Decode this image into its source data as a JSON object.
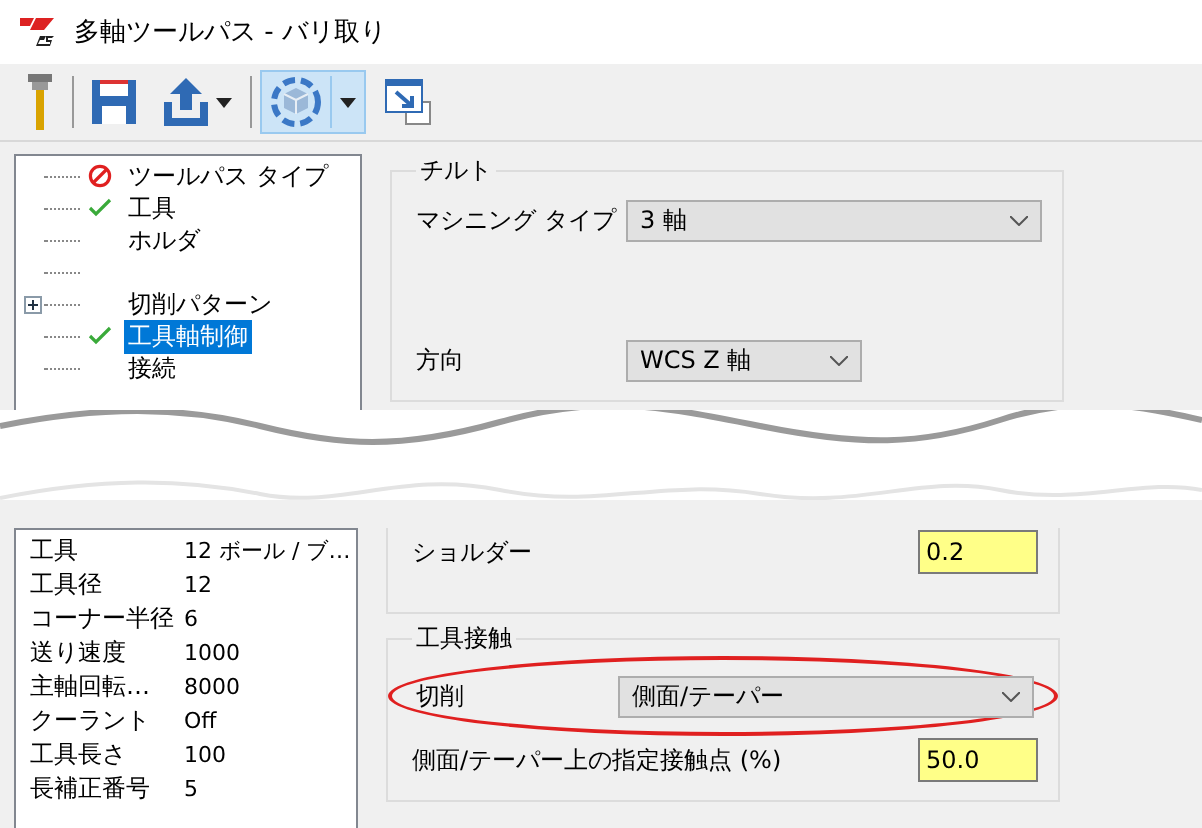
{
  "window": {
    "title": "多軸ツールパス - バリ取り"
  },
  "toolbar": [
    {
      "kind": "tool",
      "selected": false,
      "menu": false
    },
    {
      "kind": "save",
      "selected": false,
      "menu": false
    },
    {
      "kind": "export",
      "selected": false,
      "menu": true
    },
    {
      "kind": "view",
      "selected": true,
      "menu": true
    },
    {
      "kind": "window",
      "selected": false,
      "menu": false
    }
  ],
  "tree": [
    {
      "kind": "item",
      "label": "ツールパス タイプ",
      "error": true,
      "checked": false,
      "expandable": false,
      "selected": false
    },
    {
      "kind": "item",
      "label": "工具",
      "error": false,
      "checked": true,
      "expandable": false,
      "selected": false
    },
    {
      "kind": "item",
      "label": "ホルダ",
      "error": false,
      "checked": false,
      "expandable": false,
      "selected": false
    },
    {
      "kind": "blank"
    },
    {
      "kind": "item",
      "label": "切削パターン",
      "error": false,
      "checked": false,
      "expandable": true,
      "selected": false
    },
    {
      "kind": "item",
      "label": "工具軸制御",
      "error": false,
      "checked": true,
      "expandable": false,
      "selected": true
    },
    {
      "kind": "item",
      "label": "接続",
      "error": false,
      "checked": false,
      "expandable": false,
      "selected": false
    }
  ],
  "tilt": {
    "legend": "チルト",
    "machining_type": {
      "label": "マシニング タイプ",
      "value": "3 軸"
    },
    "direction": {
      "label": "方向",
      "value": "WCS Z 軸"
    }
  },
  "tool_info": [
    {
      "name": "工具",
      "value": "12 ボール / ブ…"
    },
    {
      "name": "工具径",
      "value": "12"
    },
    {
      "name": "コーナー半径",
      "value": "6"
    },
    {
      "name": "送り速度",
      "value": "1000"
    },
    {
      "name": "主軸回転…",
      "value": "8000"
    },
    {
      "name": "クーラント",
      "value": "Off"
    },
    {
      "name": "工具長さ",
      "value": "100"
    },
    {
      "name": "長補正番号",
      "value": "5"
    }
  ],
  "shoulder": {
    "label": "ショルダー",
    "value": "0.2"
  },
  "contact": {
    "legend": "工具接触",
    "cutting": {
      "label": "切削",
      "value": "側面/テーパー",
      "highlighted": true
    },
    "point": {
      "label": "側面/テーパー上の指定接触点 (%)",
      "value": "50.0"
    }
  }
}
